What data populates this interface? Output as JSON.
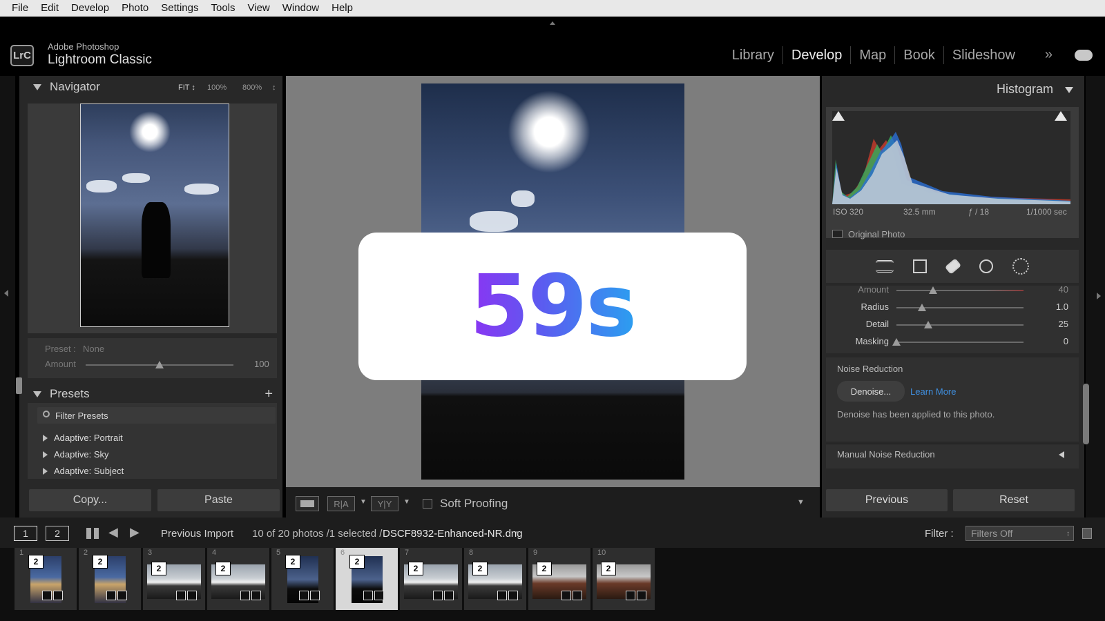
{
  "menu": [
    "File",
    "Edit",
    "Develop",
    "Photo",
    "Settings",
    "Tools",
    "View",
    "Window",
    "Help"
  ],
  "app": {
    "line1": "Adobe Photoshop",
    "line2": "Lightroom Classic",
    "logo": "LrC"
  },
  "modules": [
    "Library",
    "Develop",
    "Map",
    "Book",
    "Slideshow"
  ],
  "active_module": "Develop",
  "more_icon": "»",
  "navigator": {
    "title": "Navigator",
    "zoom": [
      "FIT ↕",
      "100%",
      "800%"
    ]
  },
  "preset_amount": {
    "preset_label": "Preset :",
    "preset_value": "None",
    "amount_label": "Amount",
    "amount_value": "100",
    "amount_fraction": 0.5
  },
  "presets": {
    "title": "Presets",
    "add_icon": "+",
    "filter_placeholder": "Filter Presets",
    "items": [
      "Adaptive: Portrait",
      "Adaptive: Sky",
      "Adaptive: Subject"
    ]
  },
  "left_buttons": {
    "copy": "Copy...",
    "paste": "Paste"
  },
  "overlay": {
    "timer": "59s"
  },
  "toolbar": {
    "soft_proofing": "Soft Proofing",
    "ra": "R|A",
    "yy": "Y|Y"
  },
  "histogram": {
    "title": "Histogram",
    "iso": "ISO 320",
    "focal": "32.5 mm",
    "aperture": "ƒ / 18",
    "shutter": "1/1000 sec",
    "original_photo": "Original Photo"
  },
  "detail": {
    "rows": [
      {
        "label": "Amount",
        "value": "40",
        "fraction": 0.29
      },
      {
        "label": "Radius",
        "value": "1.0",
        "fraction": 0.2
      },
      {
        "label": "Detail",
        "value": "25",
        "fraction": 0.25
      },
      {
        "label": "Masking",
        "value": "0",
        "fraction": 0
      }
    ]
  },
  "noise_reduction": {
    "title": "Noise Reduction",
    "denoise_button": "Denoise...",
    "learn_more": "Learn More",
    "status": "Denoise has been applied to this photo.",
    "manual": "Manual Noise Reduction"
  },
  "right_buttons": {
    "previous": "Previous",
    "reset": "Reset"
  },
  "filmbar": {
    "view1": "1",
    "view2": "2",
    "source": "Previous Import",
    "count": "10 of 20 photos /1 selected /",
    "filename": "DSCF8932-Enhanced-NR.dng",
    "filename_suffix": "▾",
    "filter_label": "Filter :",
    "filter_value": "Filters Off"
  },
  "filmstrip": [
    {
      "num": "1",
      "badge": "2",
      "orient": "portrait",
      "kind": "city"
    },
    {
      "num": "2",
      "badge": "2",
      "orient": "portrait",
      "kind": "city"
    },
    {
      "num": "3",
      "badge": "2",
      "orient": "landscape",
      "kind": "mountain"
    },
    {
      "num": "4",
      "badge": "2",
      "orient": "landscape",
      "kind": "mountain"
    },
    {
      "num": "5",
      "badge": "2",
      "orient": "portrait",
      "kind": "sun"
    },
    {
      "num": "6",
      "badge": "2",
      "orient": "portrait",
      "kind": "sun",
      "selected": true
    },
    {
      "num": "7",
      "badge": "2",
      "orient": "landscape",
      "kind": "mountain"
    },
    {
      "num": "8",
      "badge": "2",
      "orient": "landscape",
      "kind": "mountain"
    },
    {
      "num": "9",
      "badge": "2",
      "orient": "landscape",
      "kind": "bridge"
    },
    {
      "num": "10",
      "badge": "2",
      "orient": "landscape",
      "kind": "bridge"
    }
  ],
  "colors": {
    "accent_link": "#3f8fe0",
    "timer_from": "#8b34f2",
    "timer_to": "#2b9ff0",
    "bg": "#000000",
    "panel": "#282828"
  }
}
